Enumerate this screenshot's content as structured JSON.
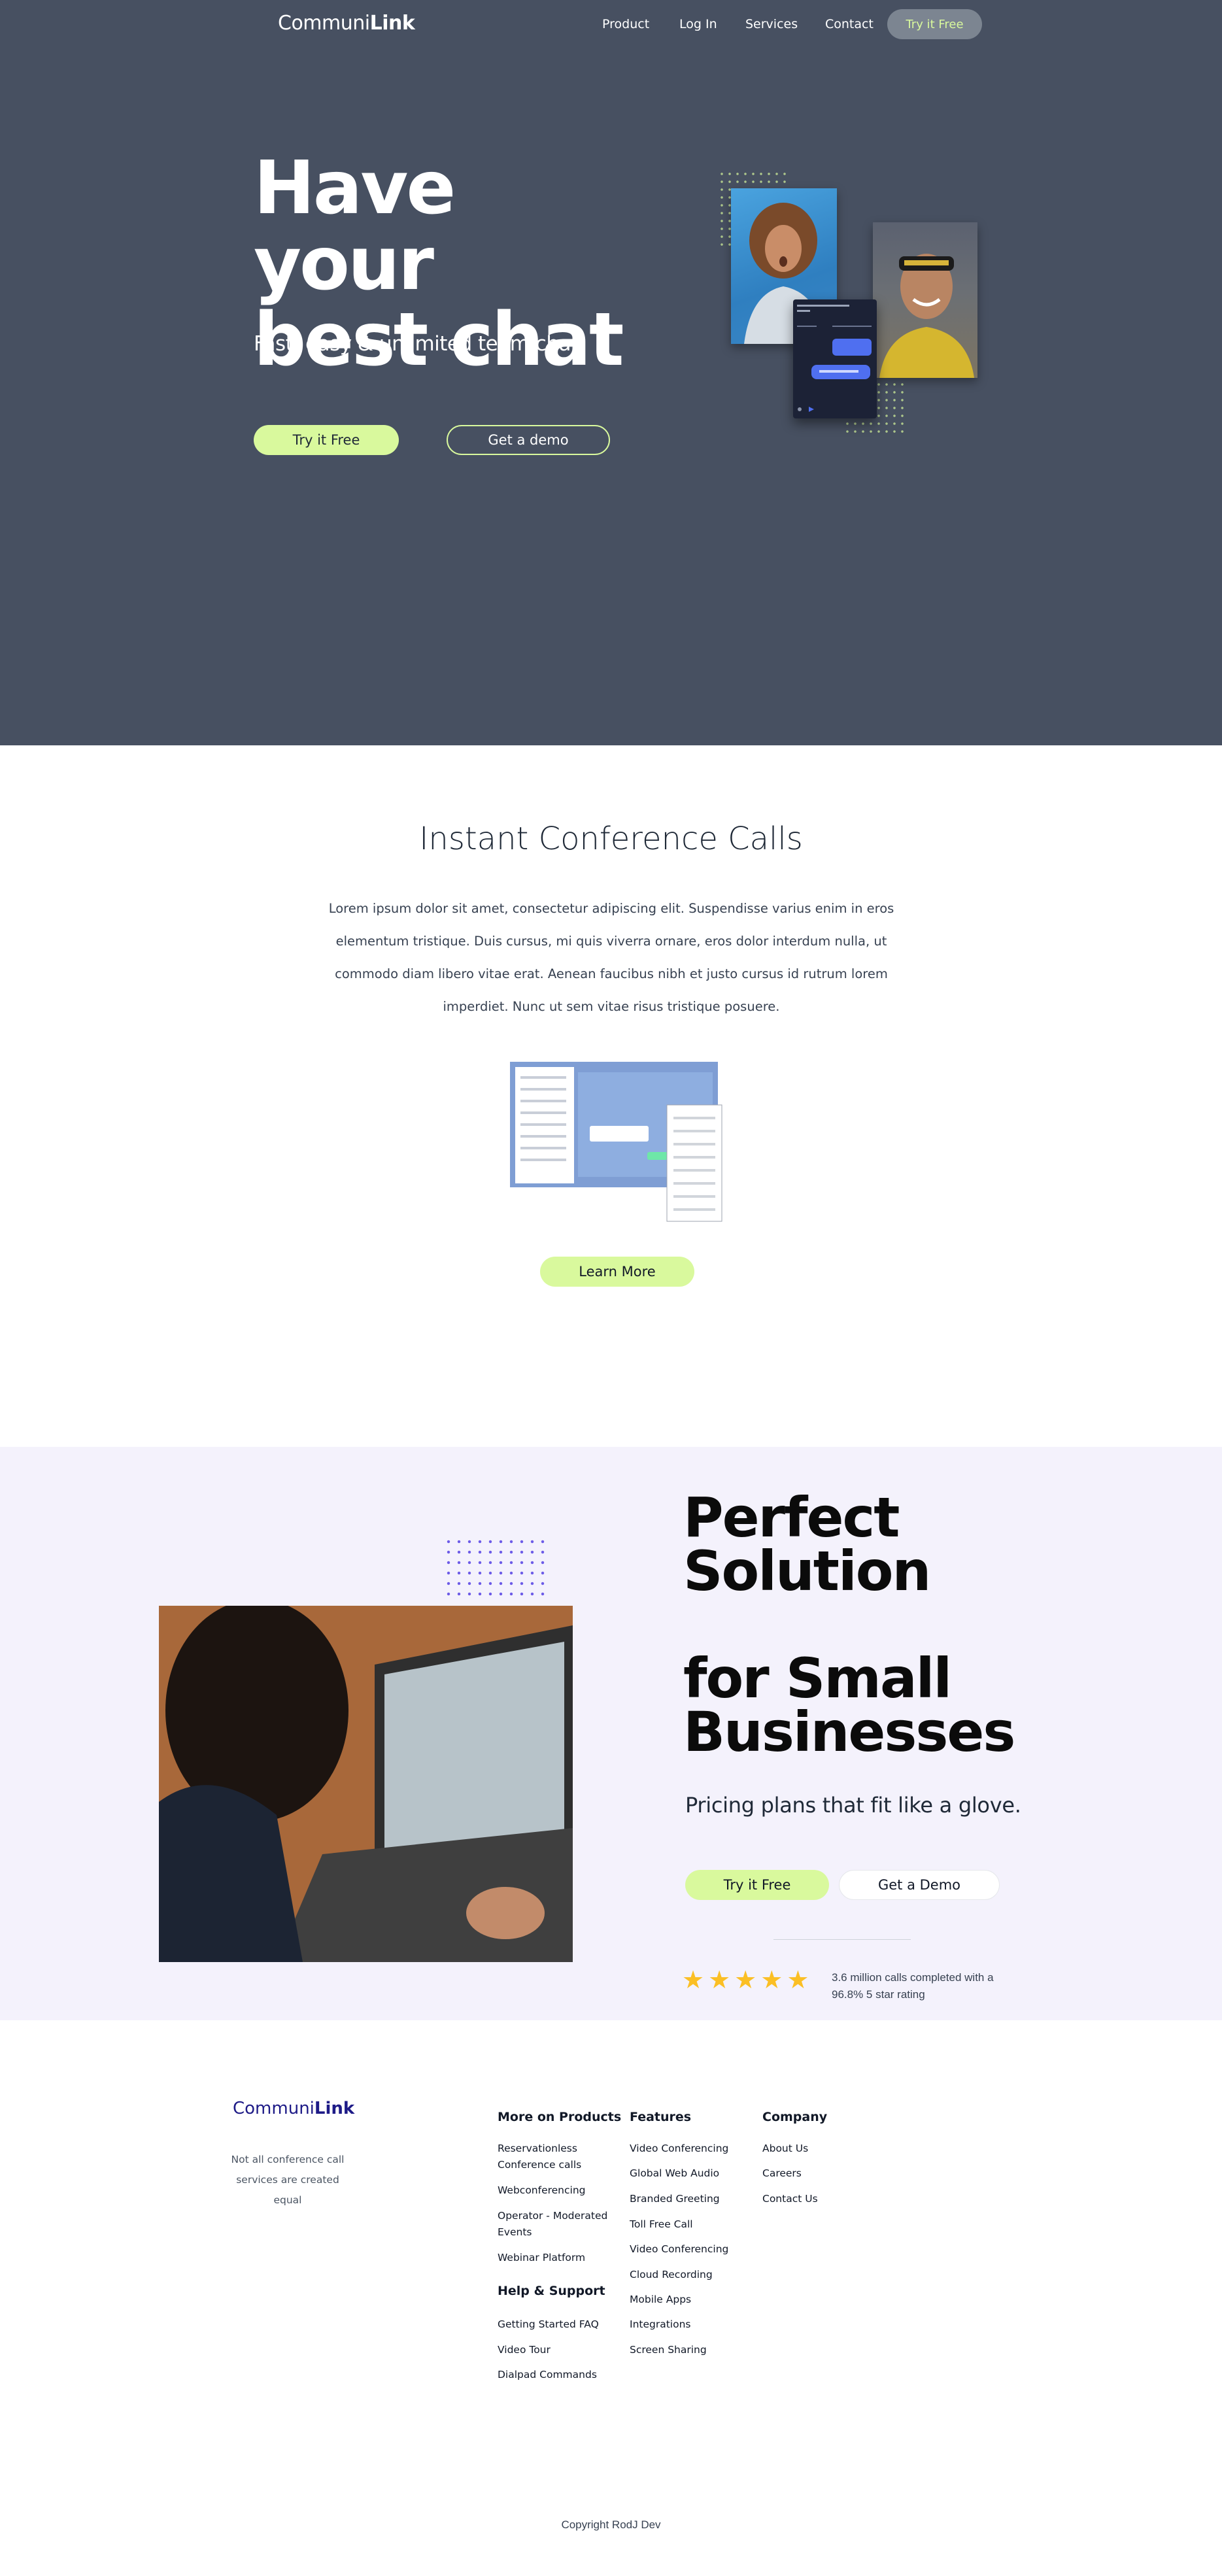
{
  "brand": {
    "prefix": "Communi",
    "suffix": "Link"
  },
  "nav": {
    "items": [
      "Product",
      "Log In",
      "Services",
      "Contact"
    ],
    "cta": "Try it Free"
  },
  "hero": {
    "title_line1": "Have your",
    "title_line2": "best chat",
    "subtitle": "Fast, easy & unlimited team chat",
    "primary_button": "Try it Free",
    "secondary_button": "Get a demo"
  },
  "conference": {
    "title": "Instant Conference Calls",
    "body": "Lorem ipsum dolor sit amet, consectetur adipiscing elit. Suspendisse varius enim in eros elementum tristique. Duis cursus, mi quis viverra ornare, eros dolor interdum nulla, ut commodo diam libero vitae erat. Aenean faucibus nibh et justo cursus id rutrum lorem imperdiet. Nunc ut sem vitae risus tristique posuere.",
    "button": "Learn More"
  },
  "solution": {
    "title": "Perfect\nSolution\n\nfor Small\nBusinesses",
    "subtitle": "Pricing plans that fit like a glove.",
    "primary_button": "Try it Free",
    "secondary_button": "Get a Demo",
    "rating_stars": 5,
    "rating_text": "3.6 million calls completed with a 96.8% 5 star rating"
  },
  "footer": {
    "tagline": "Not all conference call services are created equal",
    "columns": {
      "products": {
        "heading": "More on Products",
        "links": [
          "Reservationless Conference calls",
          "Webconferencing",
          "Operator - Moderated Events",
          "Webinar Platform"
        ]
      },
      "help": {
        "heading": "Help & Support",
        "links": [
          "Getting Started FAQ",
          "Video Tour",
          "Dialpad Commands"
        ]
      },
      "features": {
        "heading": "Features",
        "links": [
          "Video Conferencing",
          "Global Web Audio",
          "Branded Greeting",
          "Toll Free Call",
          "Video Conferencing",
          "Cloud Recording",
          "Mobile Apps",
          "Integrations",
          "Screen Sharing"
        ]
      },
      "company": {
        "heading": "Company",
        "links": [
          "About Us",
          "Careers",
          "Contact Us"
        ]
      }
    },
    "copyright": "Copyright RodJ Dev"
  },
  "colors": {
    "hero_bg": "#475061",
    "accent": "#d9f99d",
    "solution_bg": "#f4f2fc",
    "star": "#fbbf24",
    "footer_brand": "#1e1b87"
  }
}
